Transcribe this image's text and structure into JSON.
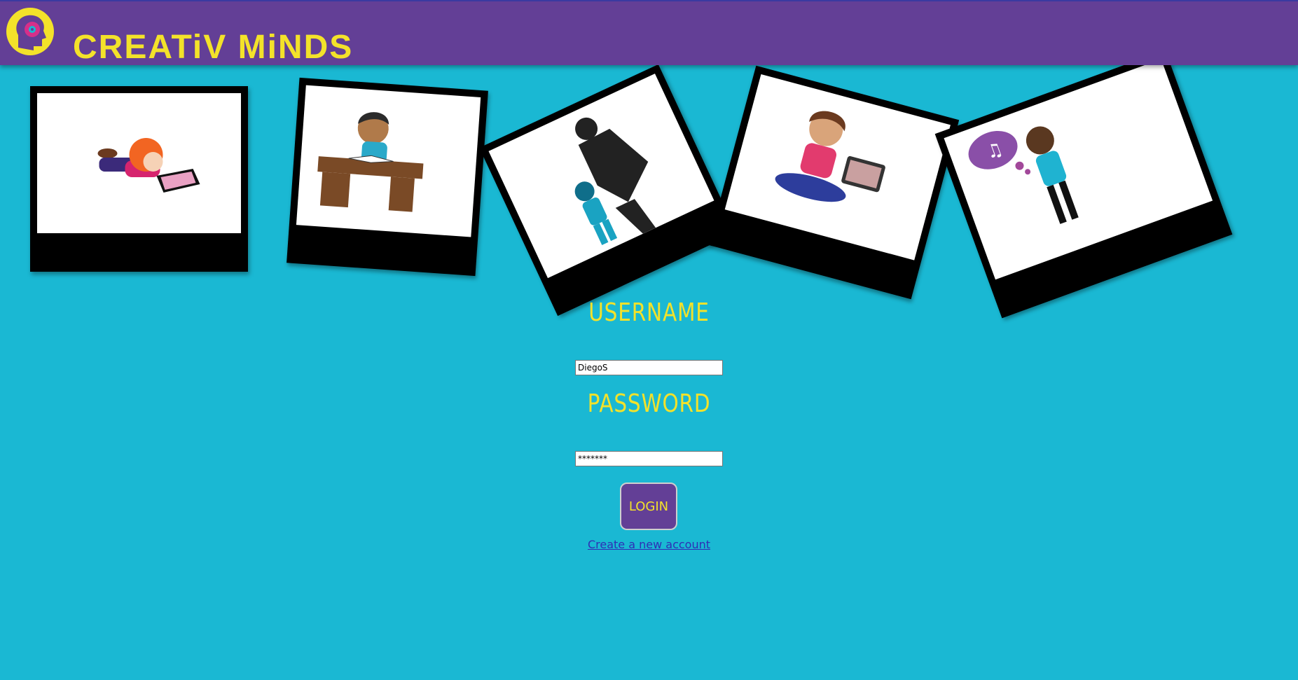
{
  "header": {
    "title": "CREATiV MiNDS",
    "logo_icon": "brain-gear-logo"
  },
  "gallery": {
    "photos": [
      {
        "icon": "girl-with-tablet-illustration"
      },
      {
        "icon": "boy-reading-at-desk-illustration"
      },
      {
        "icon": "boy-superhero-shadow-illustration"
      },
      {
        "icon": "boy-with-tablet-illustration"
      },
      {
        "icon": "girl-with-headphones-music-illustration"
      }
    ]
  },
  "login_form": {
    "username_label": "USERNAME",
    "username_value": "DiegoS",
    "password_label": "PASSWORD",
    "password_value": "*******",
    "login_button": "LOGIN",
    "create_account_link": "Create a new account"
  },
  "colors": {
    "background": "#1ab8d3",
    "header": "#633f96",
    "accent_yellow": "#f3e22a",
    "link": "#2f2fb5"
  }
}
